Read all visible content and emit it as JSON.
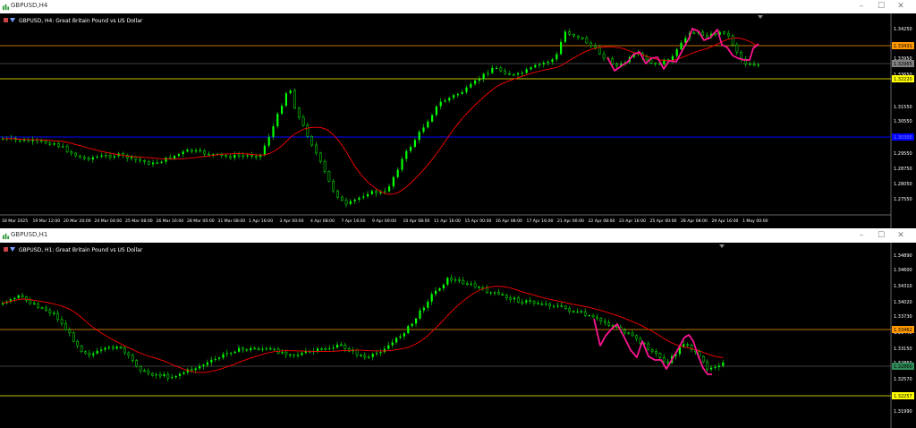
{
  "window1": {
    "title": "GBPUSD,H4",
    "header": "GBPUSD, H4:  Great Britain Pound vs US Dollar",
    "prices": [
      "1.34250",
      "1.33950",
      "1.33650",
      "1.31550",
      "1.30550",
      "1.29550",
      "1.28750",
      "1.28050",
      "1.27550"
    ],
    "levels": {
      "orange": {
        "label": "1.33431",
        "color": "#ff9800"
      },
      "gray": {
        "label": "1.32965",
        "color": "#808080"
      },
      "yellow": {
        "label": "1.32220",
        "color": "#ffff00"
      },
      "blue": {
        "label": "1.30300",
        "color": "#0000ff"
      }
    },
    "time_labels": [
      "18 Mar 2025",
      "19 Mar 12:00",
      "20 Mar 20:00",
      "24 Mar 04:00",
      "25 Mar 08:00",
      "26 Mar 16:00",
      "28 Mar 00:00",
      "31 Mar 08:00",
      "1 Apr 16:00",
      "3 Apr 00:00",
      "4 Apr 08:00",
      "7 Apr 16:00",
      "9 Apr 00:00",
      "10 Apr 08:00",
      "11 Apr 16:00",
      "15 Apr 00:00",
      "16 Apr 08:00",
      "17 Apr 16:00",
      "21 Apr 00:00",
      "22 Apr 08:00",
      "23 Apr 16:00",
      "25 Apr 00:00",
      "28 Apr 08:00",
      "29 Apr 16:00",
      "1 May 00:00"
    ]
  },
  "window2": {
    "title": "GBPUSD,H1",
    "header": "GBPUSD, H1:  Great Britain Pound vs US Dollar",
    "prices": [
      "1.34890",
      "1.34600",
      "1.34310",
      "1.34020",
      "1.33730",
      "1.33440",
      "1.33150",
      "1.32860",
      "1.32570",
      "1.32280",
      "1.31990"
    ],
    "levels": {
      "orange": {
        "label": "1.33462",
        "color": "#ff9800"
      },
      "gray": {
        "label": "1.32860",
        "color": "#808080"
      },
      "yellow": {
        "label": "1.32257",
        "color": "#ffff00"
      }
    }
  },
  "colors": {
    "candle": "#00ff00",
    "ma": "#ff0000",
    "pattern": "#ff1493",
    "background": "#000000",
    "axis_text": "#ffffff"
  },
  "icons": {
    "app": "mt5-chart-icon",
    "minimize": "minimize-icon",
    "maximize": "maximize-icon",
    "close": "close-icon"
  }
}
